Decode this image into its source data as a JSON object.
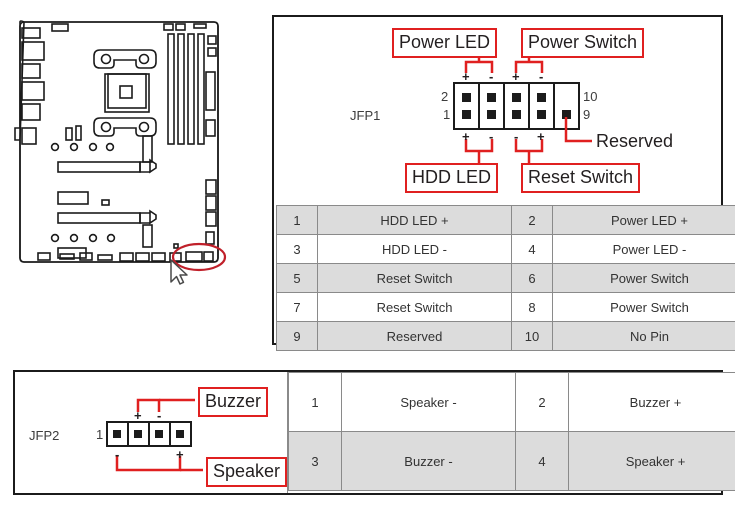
{
  "board": {
    "title": "motherboard-layout",
    "highlight_label": "jfp-connector-highlight",
    "cursor_label": "mouse-pointer"
  },
  "jfp1": {
    "connector_name": "JFP1",
    "callouts": {
      "power_led": "Power LED",
      "power_switch": "Power Switch",
      "hdd_led": "HDD LED",
      "reset_switch": "Reset Switch",
      "reserved": "Reserved"
    },
    "pin_numbers": {
      "top_left": "2",
      "bottom_left": "1",
      "top_right": "10",
      "bottom_right": "9"
    },
    "polarity_top": [
      "+",
      "-",
      "+",
      "-"
    ],
    "polarity_bottom": [
      "+",
      "-",
      "-",
      "+"
    ],
    "table": {
      "rows": [
        {
          "left_num": "1",
          "left_desc": "HDD LED +",
          "right_num": "2",
          "right_desc": "Power LED +",
          "shaded": true
        },
        {
          "left_num": "3",
          "left_desc": "HDD LED -",
          "right_num": "4",
          "right_desc": "Power LED -",
          "shaded": false
        },
        {
          "left_num": "5",
          "left_desc": "Reset Switch",
          "right_num": "6",
          "right_desc": "Power Switch",
          "shaded": true
        },
        {
          "left_num": "7",
          "left_desc": "Reset Switch",
          "right_num": "8",
          "right_desc": "Power Switch",
          "shaded": false
        },
        {
          "left_num": "9",
          "left_desc": "Reserved",
          "right_num": "10",
          "right_desc": "No Pin",
          "shaded": true
        }
      ]
    }
  },
  "jfp2": {
    "connector_name": "JFP2",
    "callouts": {
      "buzzer": "Buzzer",
      "speaker": "Speaker"
    },
    "pin_numbers": {
      "first": "1"
    },
    "polarity_top": [
      "+",
      "-"
    ],
    "polarity_bottom": [
      "-",
      "+"
    ],
    "table": {
      "rows": [
        {
          "left_num": "1",
          "left_desc": "Speaker -",
          "right_num": "2",
          "right_desc": "Buzzer +",
          "shaded": false
        },
        {
          "left_num": "3",
          "left_desc": "Buzzer -",
          "right_num": "4",
          "right_desc": "Speaker +",
          "shaded": true
        }
      ]
    }
  },
  "colors": {
    "callout_red": "#e02020",
    "shade_gray": "#dcdcdc",
    "border_gray": "#8a8a8a",
    "panel_black": "#1b1b1b"
  }
}
